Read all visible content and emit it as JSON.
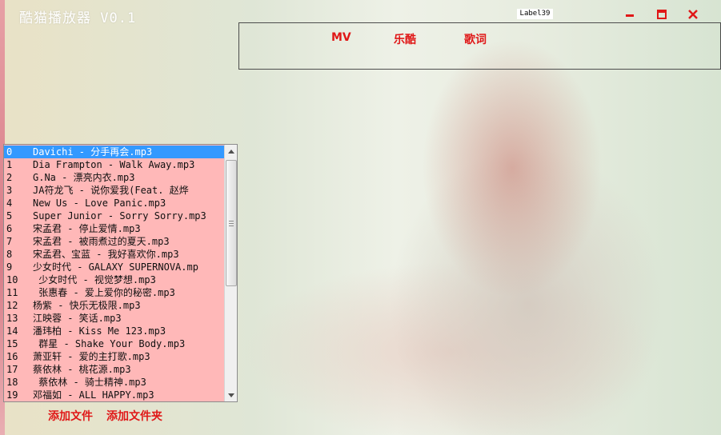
{
  "window": {
    "title": "酷猫播放器 V0.1"
  },
  "label_box": "Label39",
  "window_controls": {
    "minimize_icon": "minimize-icon",
    "maximize_icon": "maximize-icon",
    "close_icon": "close-icon",
    "color": "#e01818"
  },
  "nav": {
    "tabs": [
      {
        "label": "MV"
      },
      {
        "label": "乐酷"
      },
      {
        "label": "歌词"
      }
    ]
  },
  "playlist": {
    "selected_index": 0,
    "items": [
      {
        "num": "0",
        "name": "Davichi - 分手再会.mp3"
      },
      {
        "num": "1",
        "name": "Dia Frampton - Walk Away.mp3"
      },
      {
        "num": "2",
        "name": "G.Na - 漂亮内衣.mp3"
      },
      {
        "num": "3",
        "name": "JA符龙飞 - 说你爱我(Feat. 赵烨"
      },
      {
        "num": "4",
        "name": "New Us - Love Panic.mp3"
      },
      {
        "num": "5",
        "name": "Super Junior - Sorry Sorry.mp3"
      },
      {
        "num": "6",
        "name": "宋孟君 - 停止爱情.mp3"
      },
      {
        "num": "7",
        "name": "宋孟君 - 被雨煮过的夏天.mp3"
      },
      {
        "num": "8",
        "name": "宋孟君、宝蓝 - 我好喜欢你.mp3"
      },
      {
        "num": "9",
        "name": "少女时代 - GALAXY SUPERNOVA.mp"
      },
      {
        "num": "10",
        "name": " 少女时代 - 视觉梦想.mp3"
      },
      {
        "num": "11",
        "name": " 张惠春 - 爱上爱你的秘密.mp3"
      },
      {
        "num": "12",
        "name": "杨紫 - 快乐无极限.mp3"
      },
      {
        "num": "13",
        "name": "江映蓉 - 笑话.mp3"
      },
      {
        "num": "14",
        "name": "潘玮柏 - Kiss Me 123.mp3"
      },
      {
        "num": "15",
        "name": " 群星 - Shake Your Body.mp3"
      },
      {
        "num": "16",
        "name": "萧亚轩 - 爱的主打歌.mp3"
      },
      {
        "num": "17",
        "name": "蔡依林 - 桃花源.mp3"
      },
      {
        "num": "18",
        "name": " 蔡依林 - 骑士精神.mp3"
      },
      {
        "num": "19",
        "name": "邓福如 - ALL HAPPY.mp3"
      }
    ]
  },
  "actions": {
    "add_file": "添加文件",
    "add_folder": "添加文件夹"
  }
}
